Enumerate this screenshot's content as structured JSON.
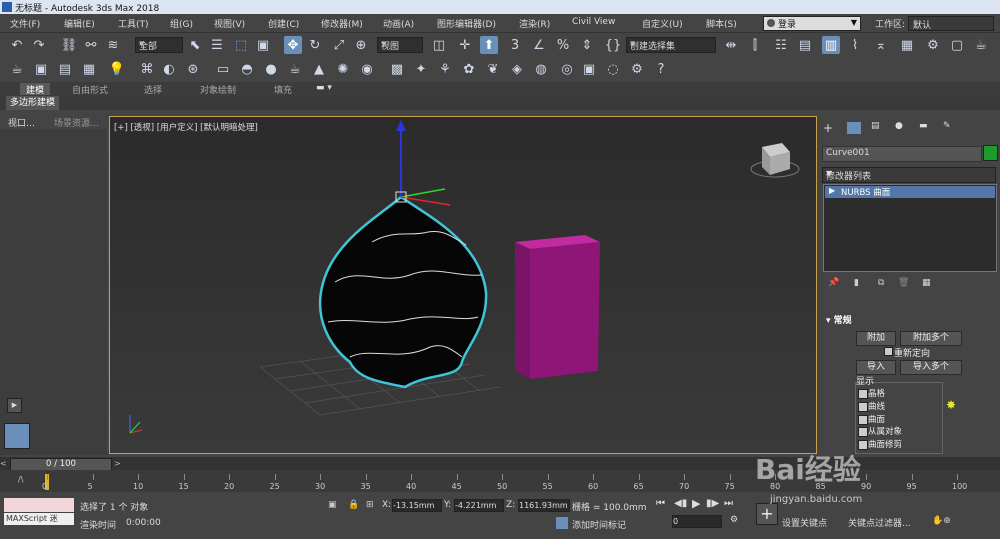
{
  "window": {
    "title": "无标题 - Autodesk 3ds Max 2018"
  },
  "menu": [
    "文件(F)",
    "编辑(E)",
    "工具(T)",
    "组(G)",
    "视图(V)",
    "创建(C)",
    "修改器(M)",
    "动画(A)",
    "图形编辑器(D)",
    "渲染(R)",
    "Civil View",
    "自定义(U)",
    "脚本(S)"
  ],
  "login": "登录",
  "workspace": {
    "label": "工作区:",
    "value": "默认"
  },
  "toolbar": {
    "filter": "全部",
    "view": "视图",
    "selection_set": "创建选择集"
  },
  "ribbon": {
    "tabs": [
      "建模",
      "自由形式",
      "选择",
      "对象绘制",
      "填充"
    ],
    "sub_tab": "多边形建模"
  },
  "left_panel": {
    "tabs": [
      "视口…",
      "场景资源…"
    ]
  },
  "viewport": {
    "label": "[+] [透视] [用户定义] [默认明暗处理]"
  },
  "right_panel": {
    "object_name": "Curve001",
    "modifier_list": "修改器列表",
    "stack_item": "NURBS 曲面",
    "rollout": "常规",
    "buttons": {
      "attach": "附加",
      "attach_multi": "附加多个",
      "reorient": "重新定向",
      "import": "导入",
      "import_multi": "导入多个"
    },
    "display_label": "显示",
    "display": [
      "晶格",
      "曲线",
      "曲面",
      "从属对象",
      "曲面修剪"
    ]
  },
  "timeline": {
    "frame": "0 / 100",
    "ticks": [
      "0",
      "5",
      "10",
      "15",
      "20",
      "25",
      "30",
      "35",
      "40",
      "45",
      "50",
      "55",
      "60",
      "65",
      "70",
      "75",
      "80",
      "85",
      "90",
      "95",
      "100"
    ]
  },
  "status": {
    "selected": "选择了 1 个 对象",
    "render_time_label": "渲染时间",
    "render_time": "0:00:00",
    "x_label": "X:",
    "x": "-13.15mm",
    "y_label": "Y:",
    "y": "-4.221mm",
    "z_label": "Z:",
    "z": "1161.93mm",
    "grid": "栅格 = 100.0mm",
    "add_time_tag": "添加时间标记",
    "set_key": "设置关键点",
    "key_filter": "关键点过滤器...",
    "maxscript": "MAXScript 迷",
    "frame_value": "0"
  },
  "watermark": {
    "text": "Bai经验",
    "url": "jingyan.baidu.com"
  }
}
